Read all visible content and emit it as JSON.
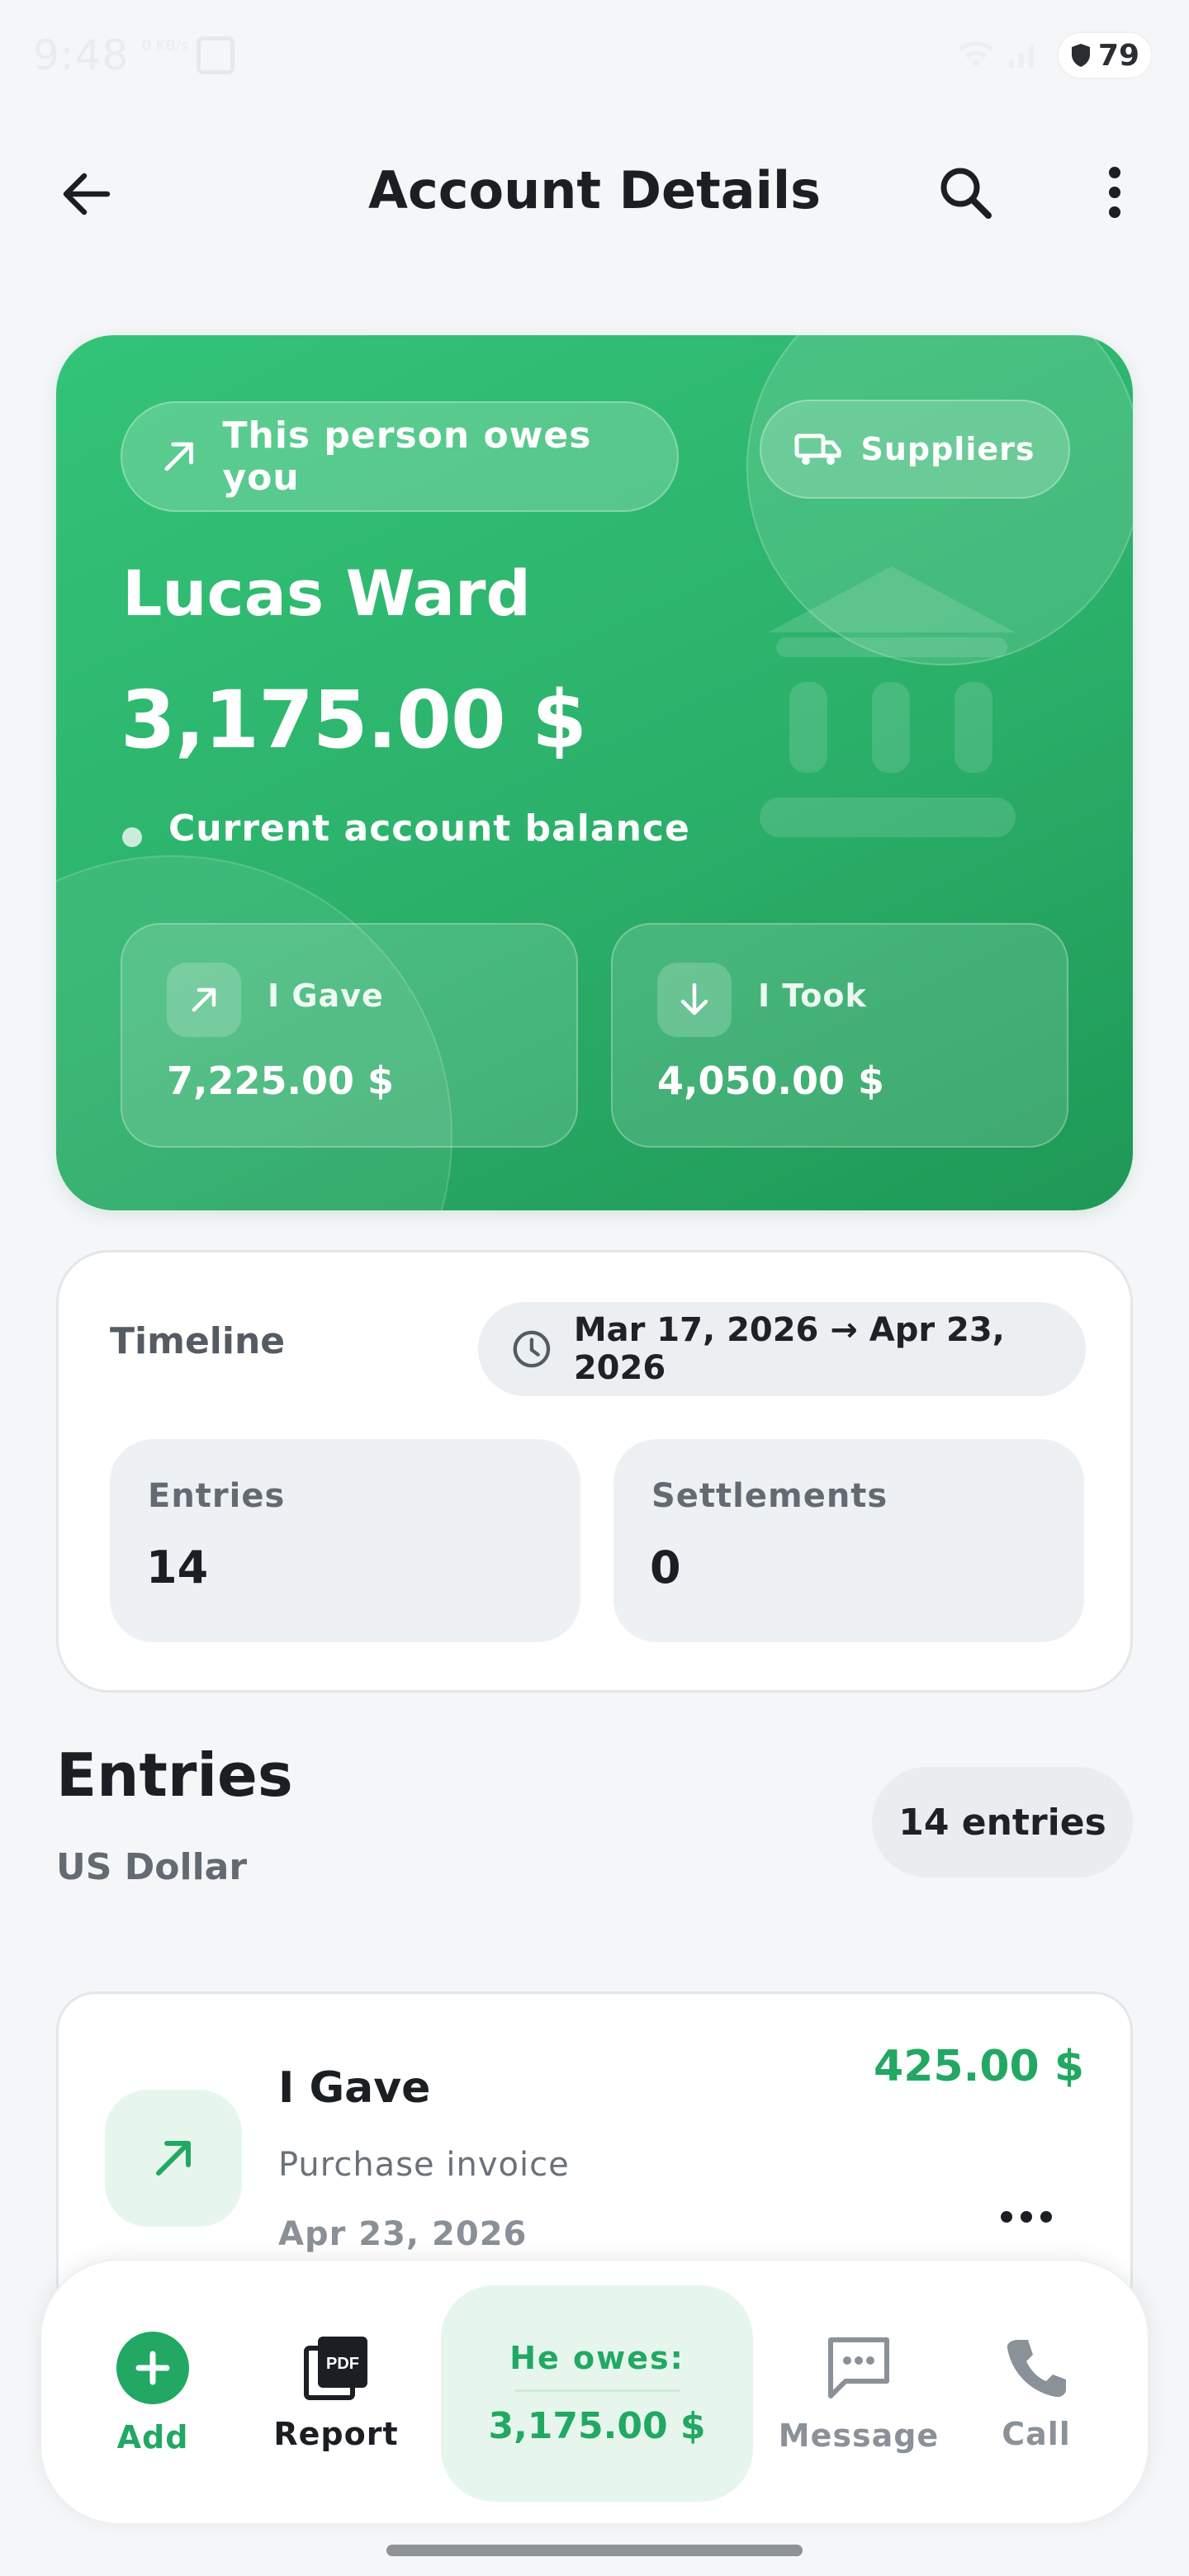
{
  "status_bar": {
    "time": "9:48",
    "sub": "0 KB/s",
    "battery": "79"
  },
  "header": {
    "title": "Account Details"
  },
  "hero": {
    "owes_label": "This person owes you",
    "category": "Suppliers",
    "name": "Lucas Ward",
    "balance": "3,175.00 $",
    "balance_label": "Current account balance",
    "gave": {
      "label": "I Gave",
      "value": "7,225.00 $"
    },
    "took": {
      "label": "I Took",
      "value": "4,050.00 $"
    },
    "accent": "#2bb06a"
  },
  "timeline": {
    "title": "Timeline",
    "range": "Mar 17, 2026 → Apr 23, 2026",
    "entries": {
      "label": "Entries",
      "value": "14"
    },
    "settlements": {
      "label": "Settlements",
      "value": "0"
    }
  },
  "entries_section": {
    "title": "Entries",
    "currency": "US Dollar",
    "count_badge": "14 entries",
    "items": [
      {
        "type": "I Gave",
        "description": "Purchase invoice",
        "date": "Apr 23, 2026",
        "amount": "425.00 $",
        "icon": "arrow-up-right-icon"
      }
    ]
  },
  "bottom_bar": {
    "add": "Add",
    "report": "Report",
    "owes_label": "He owes:",
    "owes_value": "3,175.00 $",
    "message": "Message",
    "call": "Call"
  }
}
